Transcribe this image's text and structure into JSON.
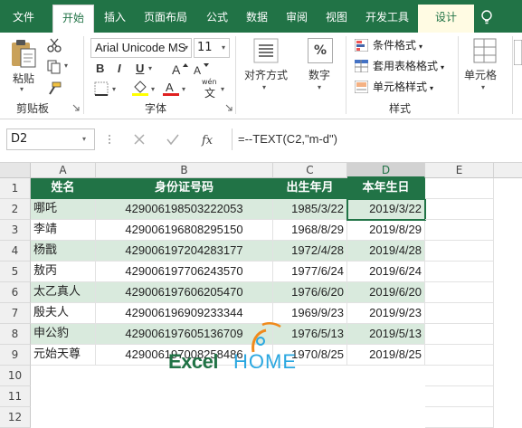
{
  "ribbon_tabs": {
    "file": "文件",
    "home": "开始",
    "insert": "插入",
    "layout": "页面布局",
    "formulas": "公式",
    "data": "数据",
    "review": "审阅",
    "view": "视图",
    "developer": "开发工具",
    "design": "设计",
    "tell": "♀"
  },
  "ribbon": {
    "paste": "粘贴",
    "clipboard_group": "剪贴板",
    "font_name": "Arial Unicode MS",
    "font_size": "11",
    "bold": "B",
    "italic": "I",
    "underline": "U",
    "font_group": "字体",
    "align": "对齐方式",
    "number": "数字",
    "percent": "%",
    "conditional_format": "条件格式",
    "table_format": "套用表格格式",
    "cell_style": "单元格样式",
    "styles_group": "样式",
    "cells": "单元格",
    "wen": "wén",
    "wen_char": "文"
  },
  "formula_bar": {
    "name_box": "D2",
    "formula": "=--TEXT(C2,\"m-d\")"
  },
  "columns": [
    "A",
    "B",
    "C",
    "D",
    "E"
  ],
  "rows": [
    "1",
    "2",
    "3",
    "4",
    "5",
    "6",
    "7",
    "8",
    "9",
    "10",
    "11",
    "12"
  ],
  "table": {
    "headers": [
      "姓名",
      "身份证号码",
      "出生年月",
      "本年生日"
    ],
    "rows": [
      [
        "哪吒",
        "429006198503222053",
        "1985/3/22",
        "2019/3/22"
      ],
      [
        "李靖",
        "429006196808295150",
        "1968/8/29",
        "2019/8/29"
      ],
      [
        "杨戬",
        "429006197204283177",
        "1972/4/28",
        "2019/4/28"
      ],
      [
        "敖丙",
        "429006197706243570",
        "1977/6/24",
        "2019/6/24"
      ],
      [
        "太乙真人",
        "429006197606205470",
        "1976/6/20",
        "2019/6/20"
      ],
      [
        "殷夫人",
        "429006196909233344",
        "1969/9/23",
        "2019/9/23"
      ],
      [
        "申公豹",
        "429006197605136709",
        "1976/5/13",
        "2019/5/13"
      ],
      [
        "元始天尊",
        "429006197008258486",
        "1970/8/25",
        "2019/8/25"
      ]
    ]
  },
  "colors": {
    "accent": "#217346",
    "band": "#d9eadd",
    "logo_blue": "#2aa7e0"
  },
  "watermark": {
    "excel": "Excel",
    "home": "HOME"
  }
}
